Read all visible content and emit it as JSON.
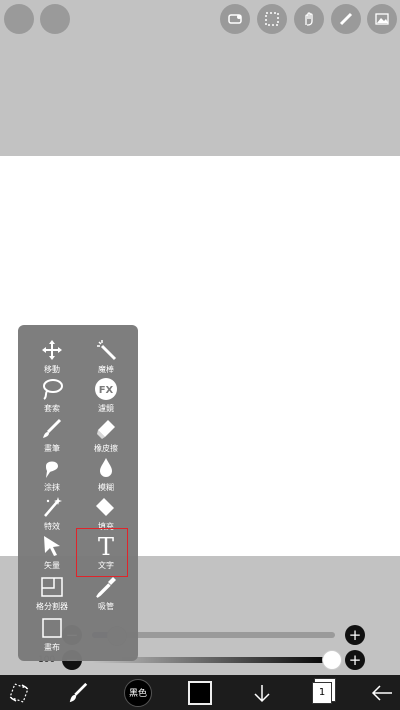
{
  "colors": {
    "toolbar_bg": "#1c1c1c",
    "panel_bg": "#7a7a7a",
    "selection": "#e0242a",
    "canvas": "#ffffff"
  },
  "top_left_buttons": [
    "circle-button-1",
    "circle-button-2"
  ],
  "top_right_icons": [
    "layer-transform-icon",
    "selection-icon",
    "hand-icon",
    "ruler-icon",
    "image-icon"
  ],
  "tools": {
    "move": "移動",
    "magic_wand": "魔棒",
    "lasso": "套索",
    "filter": "濾鏡",
    "brush": "畫筆",
    "eraser": "橡皮擦",
    "smudge": "涂抹",
    "blur": "模糊",
    "special": "特效",
    "fill": "填充",
    "pointer": "矢量",
    "text": "文字",
    "frame_divider": "格分割器",
    "eyedropper": "吸管",
    "canvas": "畫布"
  },
  "filter_icon_text": "FX",
  "text_icon_glyph": "T",
  "sliders": {
    "size": {
      "minus": "−",
      "plus": "+",
      "value": 0.1
    },
    "opacity": {
      "label": "100",
      "minus": "−",
      "plus": "+",
      "value": 1.0
    }
  },
  "bottom_bar": {
    "brush_size_label": "黑色",
    "layer_count": "1",
    "icons": [
      "transform-icon",
      "brush-icon",
      "brush-size-icon",
      "color-swatch",
      "download-icon",
      "layers-icon",
      "back-icon"
    ]
  }
}
